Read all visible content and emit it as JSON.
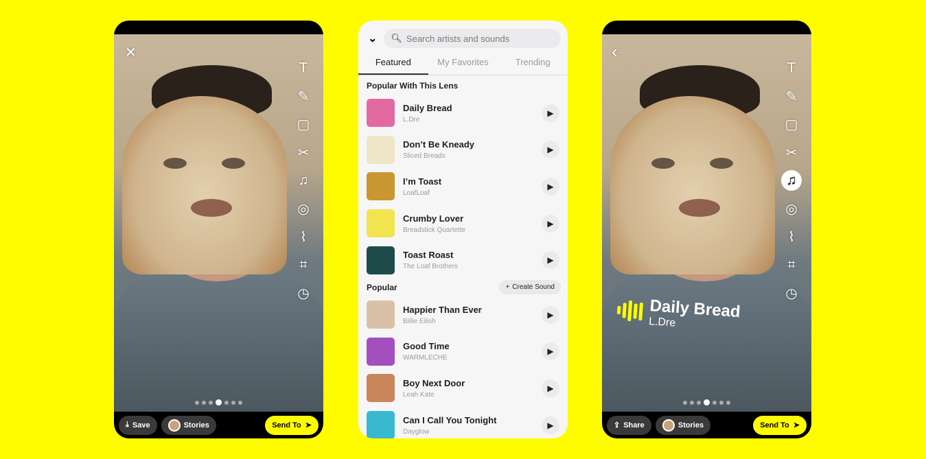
{
  "left_phone": {
    "close_icon": "✕",
    "tools": [
      "T",
      "✎",
      "▢",
      "✂",
      "♫",
      "◎",
      "⌇",
      "⌗",
      "◷"
    ],
    "save_label": "Save",
    "stories_label": "Stories",
    "send_label": "Send To"
  },
  "music_picker": {
    "search_placeholder": "Search artists and sounds",
    "tabs": [
      {
        "label": "Featured",
        "active": true
      },
      {
        "label": "My Favorites"
      },
      {
        "label": "Trending"
      }
    ],
    "section1": "Popular With This Lens",
    "section1_items": [
      {
        "title": "Daily Bread",
        "artist": "L.Dre",
        "art": "#e36aa0"
      },
      {
        "title": "Don’t Be Kneady",
        "artist": "Sliced Breads",
        "art": "#efe6c8"
      },
      {
        "title": "I’m Toast",
        "artist": "LoafLoaf",
        "art": "#c9962f"
      },
      {
        "title": "Crumby Lover",
        "artist": "Breadstick Quartette",
        "art": "#f1e44e"
      },
      {
        "title": "Toast Roast",
        "artist": "The Loaf Brothers",
        "art": "#1f4b4a"
      }
    ],
    "section2": "Popular",
    "create_sound_label": "Create Sound",
    "section2_items": [
      {
        "title": "Happier Than Ever",
        "artist": "Billie Eilish",
        "art": "#d9c1a8"
      },
      {
        "title": "Good Time",
        "artist": "WARMLECHE",
        "art": "#a44fc0"
      },
      {
        "title": "Boy Next Door",
        "artist": "Leah Kate",
        "art": "#c8865a"
      },
      {
        "title": "Can I Call You Tonight",
        "artist": "Dayglow",
        "art": "#38b9d0"
      }
    ]
  },
  "right_phone": {
    "back_icon": "‹",
    "sticker_title": "Daily Bread",
    "sticker_artist": "L.Dre",
    "share_label": "Share",
    "stories_label": "Stories",
    "send_label": "Send To",
    "active_tool": "music"
  },
  "colors": {
    "brand_yellow": "#FFFC00"
  }
}
